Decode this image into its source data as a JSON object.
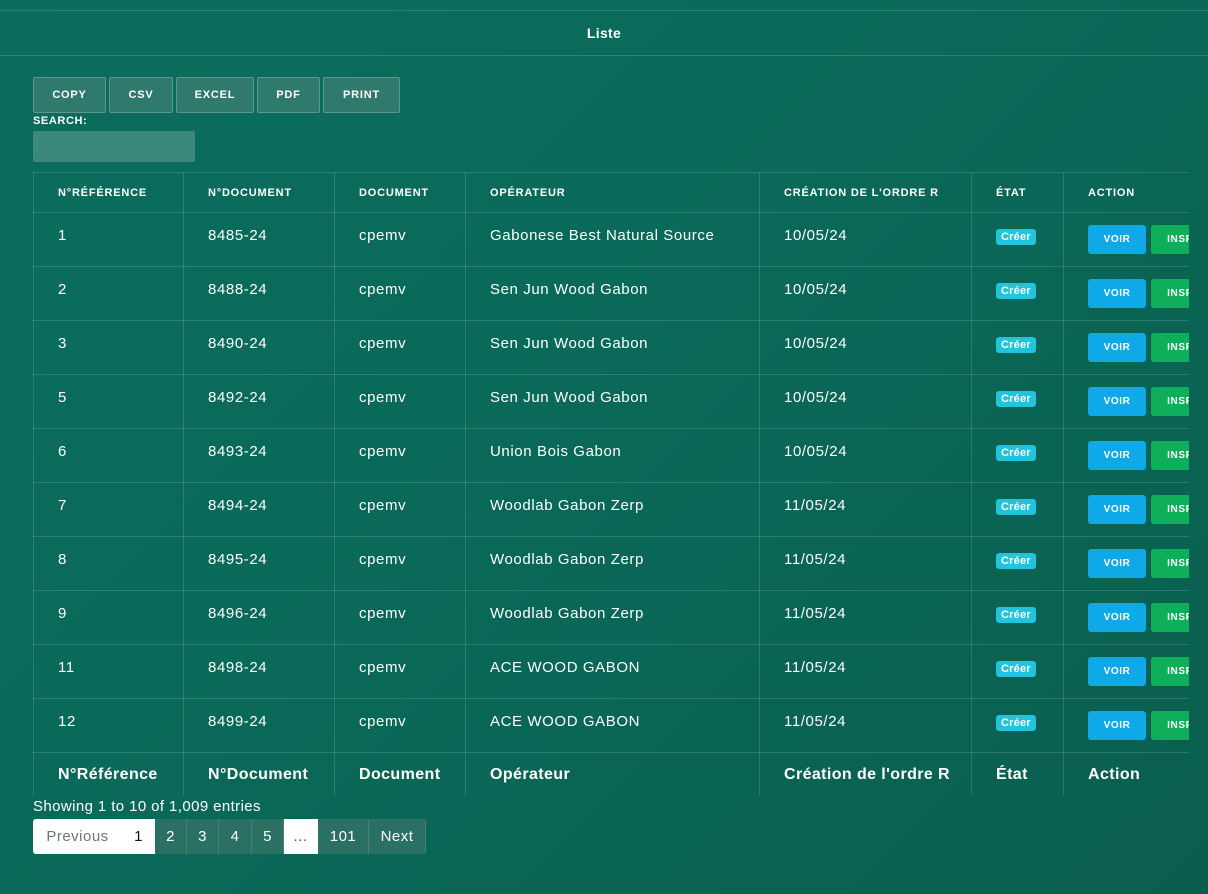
{
  "header": {
    "title": "Liste"
  },
  "toolbar": {
    "buttons": [
      {
        "label": "COPY"
      },
      {
        "label": "CSV"
      },
      {
        "label": "EXCEL"
      },
      {
        "label": "PDF"
      },
      {
        "label": "PRINT"
      }
    ]
  },
  "search": {
    "label": "SEARCH:",
    "value": ""
  },
  "table": {
    "columns": [
      "N°RÉFÉRENCE",
      "N°DOCUMENT",
      "DOCUMENT",
      "OPÉRATEUR",
      "CRÉATION DE L'ORDRE R",
      "ÉTAT",
      "ACTION"
    ],
    "footer": [
      "N°Référence",
      "N°Document",
      "Document",
      "Opérateur",
      "Création de l'ordre R",
      "État",
      "Action"
    ],
    "rows": [
      {
        "ref": "1",
        "num": "8485-24",
        "doc": "cpemv",
        "op": "Gabonese Best Natural Source",
        "date": "10/05/24",
        "etat": "Créer"
      },
      {
        "ref": "2",
        "num": "8488-24",
        "doc": "cpemv",
        "op": "Sen Jun Wood Gabon",
        "date": "10/05/24",
        "etat": "Créer"
      },
      {
        "ref": "3",
        "num": "8490-24",
        "doc": "cpemv",
        "op": "Sen Jun Wood Gabon",
        "date": "10/05/24",
        "etat": "Créer"
      },
      {
        "ref": "5",
        "num": "8492-24",
        "doc": "cpemv",
        "op": "Sen Jun Wood Gabon",
        "date": "10/05/24",
        "etat": "Créer"
      },
      {
        "ref": "6",
        "num": "8493-24",
        "doc": "cpemv",
        "op": "Union Bois Gabon",
        "date": "10/05/24",
        "etat": "Créer"
      },
      {
        "ref": "7",
        "num": "8494-24",
        "doc": "cpemv",
        "op": "Woodlab Gabon Zerp",
        "date": "11/05/24",
        "etat": "Créer"
      },
      {
        "ref": "8",
        "num": "8495-24",
        "doc": "cpemv",
        "op": "Woodlab Gabon Zerp",
        "date": "11/05/24",
        "etat": "Créer"
      },
      {
        "ref": "9",
        "num": "8496-24",
        "doc": "cpemv",
        "op": "Woodlab Gabon Zerp",
        "date": "11/05/24",
        "etat": "Créer"
      },
      {
        "ref": "11",
        "num": "8498-24",
        "doc": "cpemv",
        "op": "ACE WOOD GABON",
        "date": "11/05/24",
        "etat": "Créer"
      },
      {
        "ref": "12",
        "num": "8499-24",
        "doc": "cpemv",
        "op": "ACE WOOD GABON",
        "date": "11/05/24",
        "etat": "Créer"
      }
    ],
    "actions": {
      "voir": "VOIR",
      "insp": "INSP"
    }
  },
  "info": "Showing 1 to 10 of 1,009 entries",
  "pagination": {
    "previous": "Previous",
    "pages": [
      "1",
      "2",
      "3",
      "4",
      "5"
    ],
    "ellipsis": "…",
    "last": "101",
    "next": "Next"
  },
  "colors": {
    "background": "#0b6d5e",
    "badge": "#21c3dd",
    "voir": "#0fa9e8",
    "insp": "#0eae5a"
  }
}
